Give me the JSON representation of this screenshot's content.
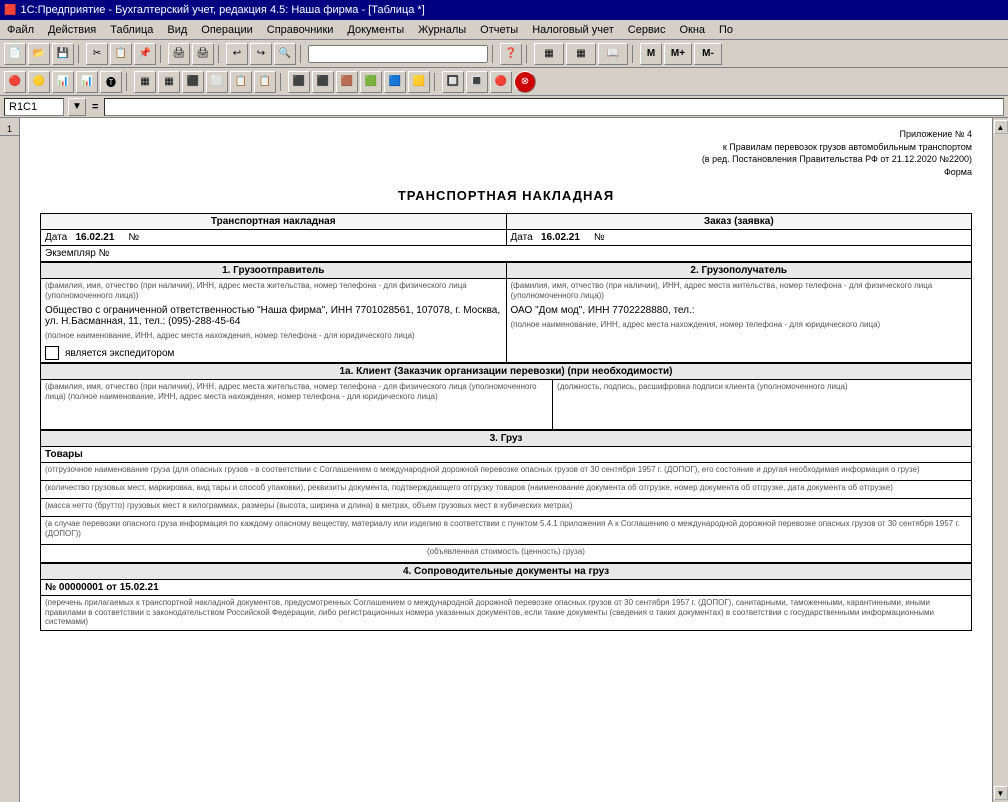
{
  "titleBar": {
    "text": "1С:Предприятие - Бухгалтерский учет, редакция 4.5: Наша фирма - [Таблица  *]",
    "icon": "🟥"
  },
  "menuBar": {
    "items": [
      "Файл",
      "Действия",
      "Таблица",
      "Вид",
      "Операции",
      "Справочники",
      "Документы",
      "Журналы",
      "Отчеты",
      "Налоговый учет",
      "Сервис",
      "Окна",
      "По"
    ]
  },
  "formulaBar": {
    "cellRef": "R1C1",
    "formula": ""
  },
  "document": {
    "headerNote": {
      "line1": "Приложение № 4",
      "line2": "к Правилам перевозок грузов автомобильным транспортом",
      "line3": "(в ред. Постановления Правительства РФ от 21.12.2020 №2200)",
      "line4": "Форма"
    },
    "title": "ТРАНСПОРТНАЯ НАКЛАДНАЯ",
    "sections": {
      "transportNote": "Транспортная накладная",
      "order": "Заказ (заявка)",
      "dateLabel": "Дата",
      "dateValue1": "16.02.21",
      "dateValue2": "16.02.21",
      "numLabel": "№",
      "copyLabel": "Экземпляр №",
      "sender": {
        "title": "1. Грузоотправитель",
        "smallText1": "(фамилия, имя, отчество (при наличии), ИНН, адрес места жительства, номер телефона - для физического лица (уполномоченного лица))",
        "mainText": "Общество с ограниченной ответственностью \"Наша фирма\", ИНН 7701028561, 107078, г. Москва, ул. Н.Басманная, 11, тел.: (095)-288-45-64",
        "smallText2": "(полное наименование, ИНН, адрес места нахождения, номер телефона - для юридического лица)",
        "expeditor": "является экспедитором"
      },
      "receiver": {
        "title": "2. Грузополучатель",
        "smallText1": "(фамилия, имя, отчество (при наличии), ИНН, адрес места жительства, номер телефона - для физического лица (уполномоченного лица))",
        "mainText": "ОАО \"Дом мод\", ИНН 7702228880, тел.:",
        "smallText2": "(полное наименование, ИНН, адрес места нахождения, номер телефона - для юридического лица)"
      },
      "client": {
        "title": "1а. Клиент (Заказчик организации перевозки) (при необходимости)",
        "smallText1": "(фамилия, имя, отчество (при наличии), ИНН, адрес места жительства, номер телефона - для физического лица (уполномоченного лица) (полное наименование, ИНН, адрес места нахождения, номер телефона - для юридического лица)",
        "smallText2": "(должность, подпись, расшифровка подписи клиента (уполномоченного лица)"
      },
      "cargo": {
        "title": "3. Груз",
        "goodsLabel": "Товары",
        "smallText1": "(отгрузочное наименование груза (для опасных грузов - в соответствии с Соглашением о международной дорожной перевозке опасных грузов от 30 сентября 1957 г. (ДОПОГ), его состояние и другая необходимая информация о грузе)",
        "smallText2": "(количество грузовых мест, маркировка, вид тары и способ упаковки), реквизиты документа, подтверждающего отгрузку товаров (наименование документа об отгрузке, номер документа об отгрузке, дата документа об отгрузке)",
        "smallText3": "(масса нетто (брутто) грузовых мест в килограммах, размеры (высота, ширина и длина) в метрах, объем грузовых мест в кубических метрах)",
        "smallText4": "(а случае перевозки опасного груза информация по каждому опасному веществу, материалу или изделию в соответствии с пунктом 5.4.1 приложения А к Соглашению о международной дорожной перевозке опасных грузов от 30 сентября 1957 г. (ДОПОГ))",
        "smallText5": "(объявленная стоимость (ценность) груза)"
      },
      "docs": {
        "title": "4. Сопроводительные документы на груз",
        "docNumber": "№ 00000001 от 15.02.21",
        "smallText1": "(перечень прилагаемых к транспортной накладной документов, предусмотренных Соглашением о международной дорожной перевозке опасных грузов от 30 сентября 1957 г. (ДОПОГ), санитарными, таможенными, карантинными, иными правилами в соответствии с законодательством Российской Федерации, либо регистрационных номера указанных документов, если такие документы (сведения о таких документах) в соответствии с государственными информационными системами)"
      }
    }
  }
}
